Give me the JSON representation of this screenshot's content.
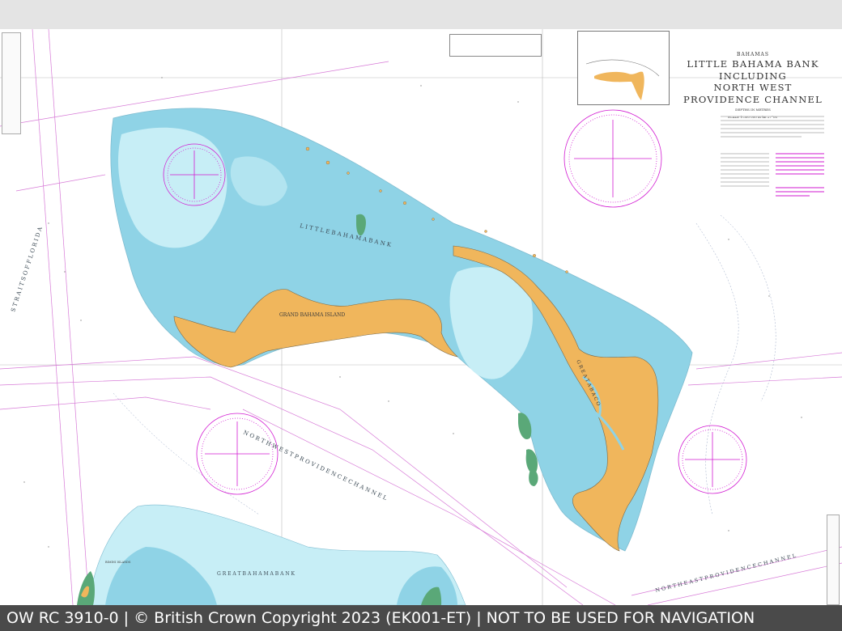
{
  "chart_title": {
    "country": "BAHAMAS",
    "lines": [
      "LITTLE BAHAMA BANK",
      "INCLUDING",
      "NORTH WEST",
      "PROVIDENCE CHANNEL"
    ],
    "depths": "DEPTHS IN METRES",
    "scale": "SCALE 1:300 000 at lat 27°00'"
  },
  "labels": {
    "little_bahama_bank": "L I T T L E   B A H A M A   B A N K",
    "grand_bahama_island": "GRAND BAHAMA ISLAND",
    "nw_providence_channel": "N O R T H   W E S T   P R O V I D E N C E   C H A N N E L",
    "straits_of_florida": "S T R A I T S   O F   F L O R I D A",
    "great_bahama_bank": "G R E A T   B A H A M A   B A N K",
    "ne_providence_channel": "N O R T H   E A S T   P R O V I D E N C E   C H A N N E L",
    "great_abaco": "G R E A T   A B A C O",
    "bimini": "BIMINI ISLANDS"
  },
  "footer": {
    "text": "OW RC 3910-0 | © British Crown Copyright 2023 (EK001-ET) | NOT TO BE USED FOR NAVIGATION"
  },
  "colors": {
    "land": "#f0b65c",
    "shallow": "#8fd3e6",
    "shoal": "#c7eef6",
    "drying": "#5aa878",
    "sea": "#ffffff",
    "magenta": "#d21ad2",
    "footer_bg": "#4a4a4a"
  }
}
